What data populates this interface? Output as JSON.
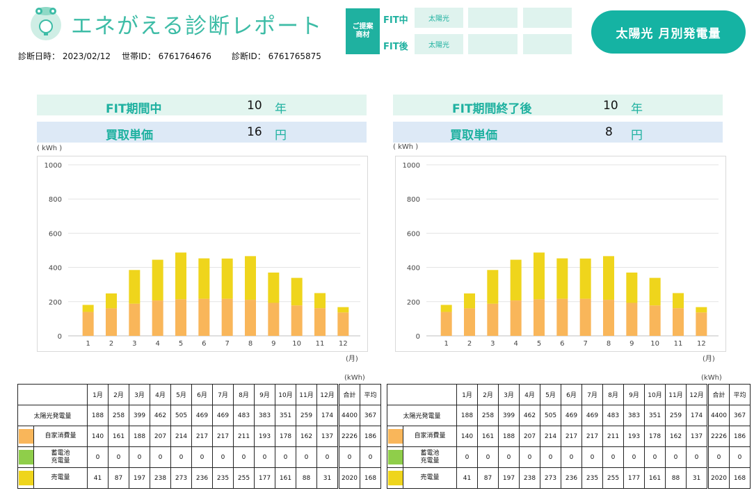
{
  "header": {
    "title": "エネがえる診断レポート",
    "meta": {
      "diag_date": "診断日時： 2023/02/12",
      "household_id": "世帯ID： 6761764676",
      "diag_id": "診断ID： 6761765875"
    },
    "proposal": {
      "badge": "ご提案商材",
      "rows": [
        {
          "label": "FIT中",
          "cells": [
            "太陽光",
            "",
            ""
          ]
        },
        {
          "label": "FIT後",
          "cells": [
            "太陽光",
            "",
            ""
          ]
        }
      ]
    },
    "main_button": "太陽光 月別発電量"
  },
  "colors": {
    "accent": "#15b3a3",
    "self": "#f9b65a",
    "battery": "#8fce4a",
    "sold": "#efd51c"
  },
  "panels": [
    {
      "period_label": "FIT期間中",
      "period_value": "10",
      "period_unit": "年",
      "price_label": "買取単価",
      "price_value": "16",
      "price_unit": "円",
      "y_unit": "( kWh )",
      "x_unit": "(月)",
      "table_unit": "(kWh)"
    },
    {
      "period_label": "FIT期間終了後",
      "period_value": "10",
      "period_unit": "年",
      "price_label": "買取単価",
      "price_value": "8",
      "price_unit": "円",
      "y_unit": "( kWh )",
      "x_unit": "(月)",
      "table_unit": "(kWh)"
    }
  ],
  "chart_data": [
    {
      "type": "bar",
      "stacked": true,
      "categories": [
        "1",
        "2",
        "3",
        "4",
        "5",
        "6",
        "7",
        "8",
        "9",
        "10",
        "11",
        "12"
      ],
      "series": [
        {
          "values": [
            140,
            161,
            188,
            207,
            214,
            217,
            217,
            211,
            193,
            178,
            162,
            137
          ]
        },
        {
          "values": [
            41,
            87,
            197,
            238,
            273,
            236,
            235,
            255,
            177,
            161,
            88,
            31
          ]
        }
      ],
      "ylim": [
        0,
        1000
      ],
      "yticks": [
        0,
        200,
        400,
        600,
        800,
        1000
      ],
      "grid": true
    },
    {
      "type": "bar",
      "stacked": true,
      "categories": [
        "1",
        "2",
        "3",
        "4",
        "5",
        "6",
        "7",
        "8",
        "9",
        "10",
        "11",
        "12"
      ],
      "series": [
        {
          "values": [
            140,
            161,
            188,
            207,
            214,
            217,
            217,
            211,
            193,
            178,
            162,
            137
          ]
        },
        {
          "values": [
            41,
            87,
            197,
            238,
            273,
            236,
            235,
            255,
            177,
            161,
            88,
            31
          ]
        }
      ],
      "ylim": [
        0,
        1000
      ],
      "yticks": [
        0,
        200,
        400,
        600,
        800,
        1000
      ],
      "grid": true
    }
  ],
  "table": {
    "headers": [
      "1月",
      "2月",
      "3月",
      "4月",
      "5月",
      "6月",
      "7月",
      "8月",
      "9月",
      "10月",
      "11月",
      "12月",
      "合計",
      "平均"
    ],
    "rows": [
      {
        "label": "太陽光発電量",
        "swatch": "",
        "values": [
          "188",
          "258",
          "399",
          "462",
          "505",
          "469",
          "469",
          "483",
          "383",
          "351",
          "259",
          "174",
          "4400",
          "367"
        ]
      },
      {
        "label": "自家消費量",
        "swatch": "#f9b65a",
        "values": [
          "140",
          "161",
          "188",
          "207",
          "214",
          "217",
          "217",
          "211",
          "193",
          "178",
          "162",
          "137",
          "2226",
          "186"
        ]
      },
      {
        "label": "蓄電池\n充電量",
        "swatch": "#8fce4a",
        "values": [
          "0",
          "0",
          "0",
          "0",
          "0",
          "0",
          "0",
          "0",
          "0",
          "0",
          "0",
          "0",
          "0",
          "0"
        ]
      },
      {
        "label": "売電量",
        "swatch": "#efd51c",
        "values": [
          "41",
          "87",
          "197",
          "238",
          "273",
          "236",
          "235",
          "255",
          "177",
          "161",
          "88",
          "31",
          "2020",
          "168"
        ]
      }
    ]
  }
}
